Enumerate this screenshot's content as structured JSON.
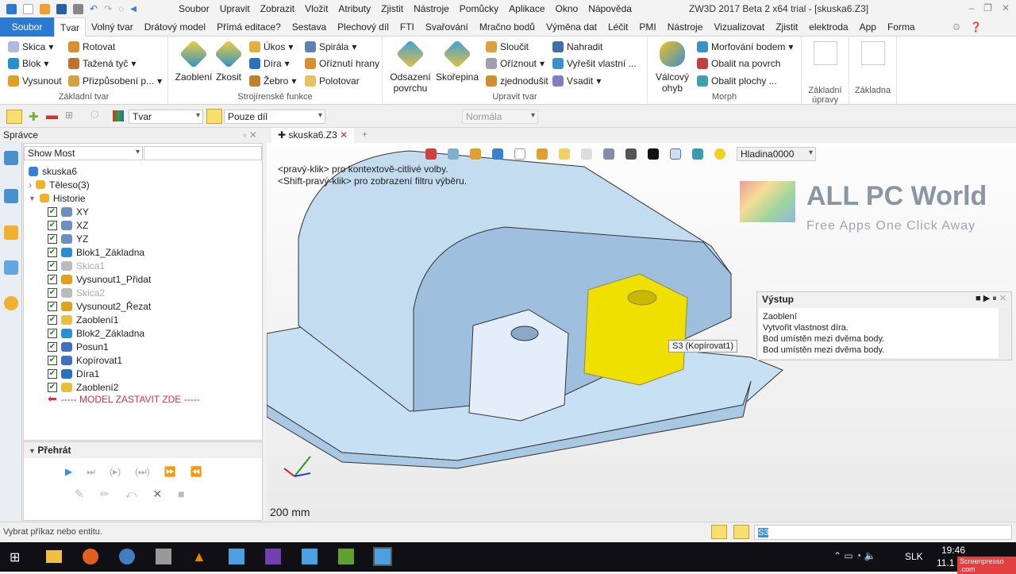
{
  "app": {
    "title": "ZW3D 2017 Beta 2 x64 trial - [skuska6.Z3]"
  },
  "menu": [
    "Soubor",
    "Upravit",
    "Zobrazit",
    "Vložit",
    "Atributy",
    "Zjistit",
    "Nástroje",
    "Pomůcky",
    "Aplikace",
    "Okno",
    "Nápověda"
  ],
  "ribbon_tabs": [
    "Soubor",
    "Tvar",
    "Volný tvar",
    "Drátový model",
    "Přímá editace?",
    "Sestava",
    "Plechový díl",
    "FTI",
    "Svařování",
    "Mračno bodů",
    "Výměna dat",
    "Léčit",
    "PMI",
    "Nástroje",
    "Vizualizovat",
    "Zjistit",
    "elektroda",
    "App",
    "Forma"
  ],
  "ribbon": {
    "zakladni": {
      "label": "Základní tvar",
      "items": [
        "Skica",
        "Blok",
        "Vysunout",
        "Rotovat",
        "Tažená tyč",
        "Přizpůsobení p..."
      ]
    },
    "stroj": {
      "label": "Strojírenské funkce",
      "big": [
        "Zaoblení",
        "Zkosit"
      ],
      "items": [
        "Úkos",
        "Díra",
        "Žebro",
        "Spirála",
        "Oříznutí hrany",
        "Polotovar"
      ]
    },
    "upravit": {
      "label": "Upravit tvar",
      "big": [
        "Odsazení povrchu",
        "Skořepina"
      ],
      "items": [
        "Sloučit",
        "Oříznout",
        "zjednodušit",
        "Nahradit",
        "Vyřešit vlastní ...",
        "Vsadit"
      ]
    },
    "morph": {
      "label": "Morph",
      "big": [
        "Válcový ohyb"
      ],
      "items": [
        "Morfování bodem",
        "Obalit na povrch",
        "Obalit plochy ..."
      ]
    },
    "extra": [
      "Základní úpravy",
      "Základna"
    ]
  },
  "toolbar": {
    "filter": "Tvar",
    "scope": "Pouze díl",
    "normal": "Normála",
    "layer": "Hladina0000"
  },
  "manager": {
    "title": "Správce",
    "filter": "Show Most",
    "root": "skuska6",
    "teleso": "Těleso(3)",
    "historie": "Historie",
    "items": [
      {
        "label": "XY",
        "color": "#6a8fc0",
        "dim": false
      },
      {
        "label": "XZ",
        "color": "#6a8fc0",
        "dim": false
      },
      {
        "label": "YZ",
        "color": "#6a8fc0",
        "dim": false
      },
      {
        "label": "Blok1_Základna",
        "color": "#2a8fd0",
        "dim": false
      },
      {
        "label": "Skica1",
        "color": "#bbbbbb",
        "dim": true
      },
      {
        "label": "Vysunout1_Přidat",
        "color": "#e0a020",
        "dim": false
      },
      {
        "label": "Skica2",
        "color": "#bbbbbb",
        "dim": true
      },
      {
        "label": "Vysunout2_Řezat",
        "color": "#e0a020",
        "dim": false
      },
      {
        "label": "Zaoblení1",
        "color": "#e8c040",
        "dim": false
      },
      {
        "label": "Blok2_Základna",
        "color": "#2a8fd0",
        "dim": false
      },
      {
        "label": "Posun1",
        "color": "#4070c0",
        "dim": false
      },
      {
        "label": "Kopírovat1",
        "color": "#4070c0",
        "dim": false
      },
      {
        "label": "Díra1",
        "color": "#2a70c0",
        "dim": false
      },
      {
        "label": "Zaoblení2",
        "color": "#e8c040",
        "dim": false
      }
    ],
    "stop": "----- MODEL ZASTAVIT ZDE -----"
  },
  "playback": {
    "title": "Přehrát"
  },
  "doc_tab": "skuska6.Z3",
  "viewport": {
    "hint1": "<pravý-klik> pro kontextově-citlivé volby.",
    "hint2": "<Shift-pravý-klik> pro zobrazení filtru výběru.",
    "tooltip": "S3 (Kopírovat1)",
    "scale": "200 mm",
    "watermark_title": "ALL PC World",
    "watermark_sub": "Free Apps One Click Away"
  },
  "output": {
    "title": "Výstup",
    "lines": [
      "Zaoblení",
      "Vytvořit vlastnost díra.",
      "Bod umístěn mezi dvěma body.",
      "Bod umístěn mezi dvěma body."
    ]
  },
  "status": {
    "text": "Vybrat příkaz nebo entitu.",
    "field": "S3"
  },
  "taskbar": {
    "lang": "SLK",
    "time": "19:46",
    "date": "11.1",
    "badge": "Screenpresso .com"
  },
  "colors": {
    "accent": "#2b79d0",
    "selection": "#f0e000",
    "model": "#b9d7f0"
  }
}
